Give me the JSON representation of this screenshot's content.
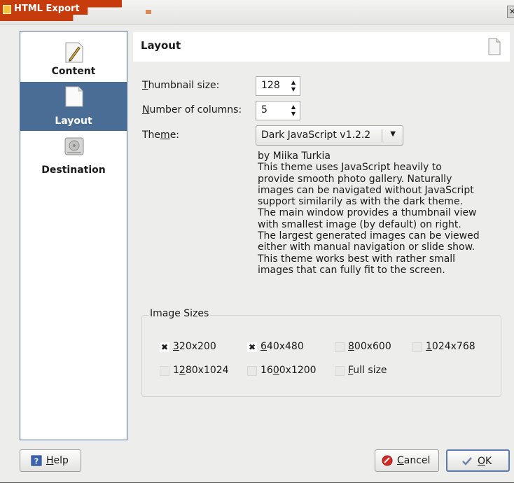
{
  "window": {
    "title": "HTML Export",
    "close_glyph": "✕"
  },
  "sidebar": {
    "items": [
      {
        "label": "Content",
        "icon": "pen-document-icon"
      },
      {
        "label": "Layout",
        "icon": "blank-document-icon",
        "selected": true
      },
      {
        "label": "Destination",
        "icon": "hard-drive-icon"
      }
    ]
  },
  "header": {
    "title": "Layout",
    "icon": "blank-document-icon"
  },
  "fields": {
    "thumbnail_size": {
      "label_ul": "T",
      "label_rest": "humbnail size:",
      "value": "128"
    },
    "columns": {
      "label_ul": "N",
      "label_rest": "umber of columns:",
      "value": "5"
    },
    "theme": {
      "label_pre": "The",
      "label_ul": "m",
      "label_post": "e:",
      "value": "Dark JavaScript v1.2.2"
    }
  },
  "theme_description": "by Miika Turkia\n This theme uses JavaScript heavily to\nprovide smooth photo gallery. Naturally\nimages can be navigated without JavaScript\nsupport similarily as with the dark theme.\nThe main window provides a thumbnail view\nwith smallest image (by default) on right.\nThe largest generated images can be viewed\neither with manual navigation or slide show.\nThis theme works best with rather small\nimages that can fully fit to the screen.",
  "image_sizes": {
    "title": "Image Sizes",
    "check_glyph": "✖",
    "options": [
      {
        "pre": "",
        "ul": "3",
        "post": "20x200",
        "checked": true
      },
      {
        "pre": "",
        "ul": "6",
        "post": "40x480",
        "checked": true
      },
      {
        "pre": "",
        "ul": "8",
        "post": "00x600",
        "checked": false
      },
      {
        "pre": "",
        "ul": "1",
        "post": "024x768",
        "checked": false
      },
      {
        "pre": "1",
        "ul": "2",
        "post": "80x1024",
        "checked": false
      },
      {
        "pre": "16",
        "ul": "0",
        "post": "0x1200",
        "checked": false
      },
      {
        "pre": "",
        "ul": "F",
        "post": "ull size",
        "checked": false
      }
    ]
  },
  "buttons": {
    "help": {
      "ul": "H",
      "rest": "elp",
      "icon": "help-icon"
    },
    "cancel": {
      "ul": "C",
      "rest": "ancel",
      "icon": "cancel-icon"
    },
    "ok": {
      "ul": "O",
      "rest": "K",
      "icon": "checkmark-icon"
    }
  },
  "colors": {
    "title_bar_accent": "#c63c0c",
    "selection": "#4a6d96",
    "window_bg": "#ededec"
  }
}
